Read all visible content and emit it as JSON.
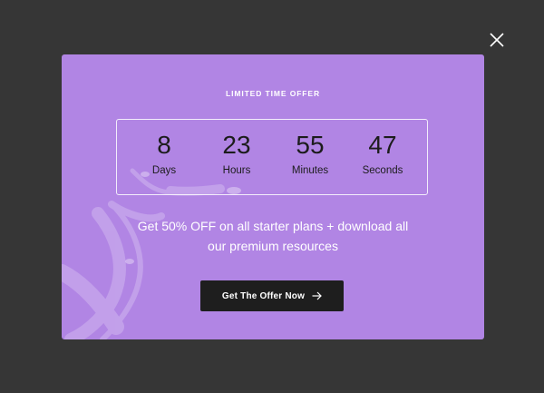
{
  "modal": {
    "eyebrow": "LIMITED TIME OFFER",
    "countdown": [
      {
        "value": "8",
        "label": "Days"
      },
      {
        "value": "23",
        "label": "Hours"
      },
      {
        "value": "55",
        "label": "Minutes"
      },
      {
        "value": "47",
        "label": "Seconds"
      }
    ],
    "promo_line1": "Get 50% OFF on all starter plans + download all",
    "promo_line2": "our premium resources",
    "cta_label": "Get The Offer Now",
    "cta_icon": "arrow-right-icon",
    "background_color": "#b185e4"
  },
  "close_icon": "close-icon",
  "overlay_color": "#363636"
}
